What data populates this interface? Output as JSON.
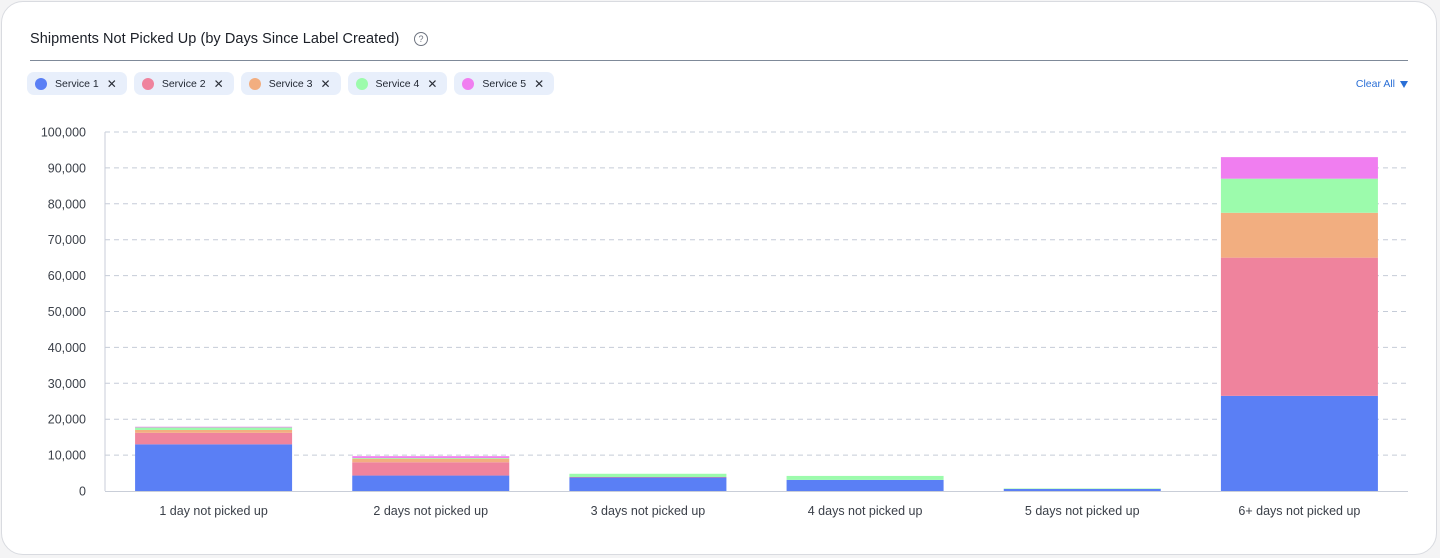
{
  "header": {
    "title": "Shipments Not Picked Up (by Days Since Label Created)",
    "help_glyph": "?"
  },
  "filters": {
    "chips": [
      {
        "label": "Service 1",
        "color": "#5a7ff5"
      },
      {
        "label": "Service 2",
        "color": "#ef839d"
      },
      {
        "label": "Service 3",
        "color": "#f2ae80"
      },
      {
        "label": "Service 4",
        "color": "#9cfbac"
      },
      {
        "label": "Service 5",
        "color": "#f07ef0"
      }
    ],
    "close_glyph": "✕",
    "clear_all_label": "Clear All"
  },
  "chart_data": {
    "type": "bar",
    "stacked": true,
    "categories": [
      "1 day not picked up",
      "2 days not picked up",
      "3 days not picked up",
      "4 days not picked up",
      "5 days not picked up",
      "6+ days not picked up"
    ],
    "series": [
      {
        "name": "Service 1",
        "color": "#5a7ff5",
        "values": [
          13000,
          4300,
          3800,
          3100,
          600,
          26500
        ]
      },
      {
        "name": "Service 2",
        "color": "#ef839d",
        "values": [
          3200,
          3700,
          100,
          0,
          0,
          38500
        ]
      },
      {
        "name": "Service 3",
        "color": "#f2ae80",
        "values": [
          800,
          1000,
          0,
          0,
          0,
          12500
        ]
      },
      {
        "name": "Service 4",
        "color": "#9cfbac",
        "values": [
          700,
          200,
          900,
          1100,
          100,
          9500
        ]
      },
      {
        "name": "Service 5",
        "color": "#f07ef0",
        "values": [
          200,
          500,
          0,
          0,
          0,
          6000
        ]
      }
    ],
    "ylim": [
      0,
      100000
    ],
    "yticks": [
      0,
      10000,
      20000,
      30000,
      40000,
      50000,
      60000,
      70000,
      80000,
      90000,
      100000
    ],
    "ytick_labels": [
      "0",
      "10,000",
      "20,000",
      "30,000",
      "40,000",
      "50,000",
      "60,000",
      "70,000",
      "80,000",
      "90,000",
      "100,000"
    ],
    "grid": true,
    "legend": "top-left"
  }
}
